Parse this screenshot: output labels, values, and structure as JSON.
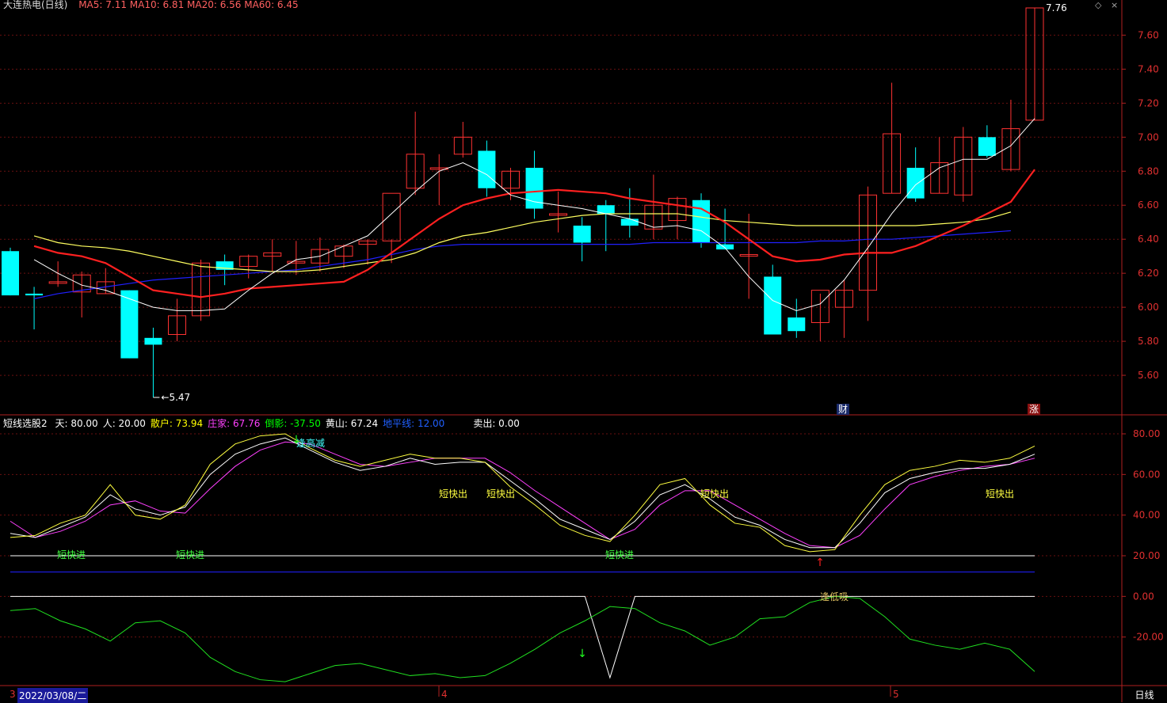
{
  "header": {
    "title_partial": "大连热电(日线)",
    "ma_partial": "MA5: 7.11  MA10: 6.81  MA20: 6.56  MA60: 6.45"
  },
  "top_controls": {
    "up": "◇",
    "close": "×"
  },
  "price_axis": {
    "ticks": [
      "7.60",
      "7.40",
      "7.20",
      "7.00",
      "6.80",
      "6.60",
      "6.40",
      "6.20",
      "6.00",
      "5.80",
      "5.60"
    ]
  },
  "price_labels": {
    "high": "7.76",
    "low": "5.47"
  },
  "badges": {
    "cai": "财",
    "zhang": "涨"
  },
  "indicator": {
    "name": "短线选股2",
    "params": [
      {
        "label": "天: 80.00",
        "color": "#ffffff"
      },
      {
        "label": "人: 20.00",
        "color": "#ffffff"
      },
      {
        "label": "散户: 73.94",
        "color": "#ffff00"
      },
      {
        "label": "庄家: 67.76",
        "color": "#ff40ff"
      },
      {
        "label": "倒影: -37.50",
        "color": "#00ff00"
      },
      {
        "label": "黄山: 67.24",
        "color": "#ffffff"
      },
      {
        "label": "地平线: 12.00",
        "color": "#2060ff"
      },
      {
        "label": "卖出: 0.00",
        "color": "#ffffff"
      }
    ],
    "axis_ticks": [
      "80.00",
      "60.00",
      "40.00",
      "20.00",
      "0.00",
      "-20.00"
    ],
    "signals": {
      "kuaijin": "短快进",
      "kuaichu": "短快出",
      "fenggaojian": "逢高减",
      "fengdixi": "逢低吸"
    }
  },
  "bottom": {
    "date": "2022/03/08/二",
    "month4": "4",
    "month5": "5",
    "period": "日线",
    "left_tick": "3"
  },
  "colors": {
    "up": "#ff3232",
    "down": "#00ffff",
    "ma5": "#ffffff",
    "ma10": "#ff2020",
    "ma20": "#ffff60",
    "ma60": "#2020ff"
  },
  "chart_data": {
    "type": "candlestick",
    "candles": [
      {
        "o": 6.33,
        "h": 6.35,
        "l": 6.07,
        "c": 6.07
      },
      {
        "o": 6.08,
        "h": 6.12,
        "l": 5.87,
        "c": 6.07
      },
      {
        "o": 6.15,
        "h": 6.27,
        "l": 6.12,
        "c": 6.15
      },
      {
        "o": 6.09,
        "h": 6.21,
        "l": 5.94,
        "c": 6.19
      },
      {
        "o": 6.08,
        "h": 6.23,
        "l": 6.08,
        "c": 6.15
      },
      {
        "o": 6.1,
        "h": 6.1,
        "l": 5.7,
        "c": 5.7
      },
      {
        "o": 5.82,
        "h": 5.88,
        "l": 5.47,
        "c": 5.78
      },
      {
        "o": 5.84,
        "h": 6.05,
        "l": 5.8,
        "c": 5.95
      },
      {
        "o": 5.95,
        "h": 6.28,
        "l": 5.92,
        "c": 6.26
      },
      {
        "o": 6.27,
        "h": 6.31,
        "l": 6.13,
        "c": 6.22
      },
      {
        "o": 6.24,
        "h": 6.31,
        "l": 6.17,
        "c": 6.3
      },
      {
        "o": 6.3,
        "h": 6.4,
        "l": 6.21,
        "c": 6.32
      },
      {
        "o": 6.26,
        "h": 6.39,
        "l": 6.19,
        "c": 6.27
      },
      {
        "o": 6.26,
        "h": 6.41,
        "l": 6.21,
        "c": 6.34
      },
      {
        "o": 6.3,
        "h": 6.37,
        "l": 6.23,
        "c": 6.36
      },
      {
        "o": 6.37,
        "h": 6.4,
        "l": 6.25,
        "c": 6.39
      },
      {
        "o": 6.39,
        "h": 6.4,
        "l": 6.26,
        "c": 6.67
      },
      {
        "o": 6.7,
        "h": 7.15,
        "l": 6.66,
        "c": 6.9
      },
      {
        "o": 6.82,
        "h": 6.9,
        "l": 6.6,
        "c": 6.82
      },
      {
        "o": 6.9,
        "h": 7.09,
        "l": 6.88,
        "c": 7.0
      },
      {
        "o": 6.92,
        "h": 6.98,
        "l": 6.65,
        "c": 6.7
      },
      {
        "o": 6.7,
        "h": 6.82,
        "l": 6.63,
        "c": 6.8
      },
      {
        "o": 6.82,
        "h": 6.92,
        "l": 6.52,
        "c": 6.58
      },
      {
        "o": 6.55,
        "h": 6.68,
        "l": 6.44,
        "c": 6.55
      },
      {
        "o": 6.48,
        "h": 6.53,
        "l": 6.27,
        "c": 6.38
      },
      {
        "o": 6.6,
        "h": 6.63,
        "l": 6.33,
        "c": 6.55
      },
      {
        "o": 6.52,
        "h": 6.7,
        "l": 6.41,
        "c": 6.48
      },
      {
        "o": 6.46,
        "h": 6.78,
        "l": 6.4,
        "c": 6.6
      },
      {
        "o": 6.51,
        "h": 6.65,
        "l": 6.4,
        "c": 6.64
      },
      {
        "o": 6.63,
        "h": 6.67,
        "l": 6.35,
        "c": 6.38
      },
      {
        "o": 6.37,
        "h": 6.58,
        "l": 6.34,
        "c": 6.34
      },
      {
        "o": 6.31,
        "h": 6.55,
        "l": 6.05,
        "c": 6.31
      },
      {
        "o": 6.18,
        "h": 6.25,
        "l": 5.84,
        "c": 5.84
      },
      {
        "o": 5.94,
        "h": 6.05,
        "l": 5.82,
        "c": 5.86
      },
      {
        "o": 5.91,
        "h": 6.08,
        "l": 5.8,
        "c": 6.1
      },
      {
        "o": 6.0,
        "h": 6.16,
        "l": 5.82,
        "c": 6.1
      },
      {
        "o": 6.1,
        "h": 6.71,
        "l": 5.92,
        "c": 6.66
      },
      {
        "o": 6.67,
        "h": 7.32,
        "l": 6.67,
        "c": 7.02
      },
      {
        "o": 6.82,
        "h": 6.94,
        "l": 6.62,
        "c": 6.64
      },
      {
        "o": 6.67,
        "h": 7.0,
        "l": 6.67,
        "c": 6.85
      },
      {
        "o": 6.66,
        "h": 7.06,
        "l": 6.62,
        "c": 7.0
      },
      {
        "o": 7.0,
        "h": 7.07,
        "l": 6.88,
        "c": 6.89
      },
      {
        "o": 6.81,
        "h": 7.22,
        "l": 6.8,
        "c": 7.05
      },
      {
        "o": 7.1,
        "h": 7.76,
        "l": 7.1,
        "c": 7.76
      }
    ],
    "ma5": [
      6.28,
      6.2,
      6.13,
      6.1,
      6.05,
      6.0,
      5.98,
      5.98,
      5.99,
      6.1,
      6.2,
      6.28,
      6.3,
      6.36,
      6.42,
      6.55,
      6.68,
      6.8,
      6.85,
      6.78,
      6.66,
      6.62,
      6.6,
      6.58,
      6.55,
      6.52,
      6.47,
      6.48,
      6.45,
      6.35,
      6.18,
      6.04,
      5.98,
      6.02,
      6.16,
      6.35,
      6.55,
      6.72,
      6.82,
      6.87,
      6.87,
      6.95,
      7.11
    ],
    "ma10": [
      6.36,
      6.32,
      6.3,
      6.26,
      6.18,
      6.1,
      6.08,
      6.06,
      6.08,
      6.11,
      6.12,
      6.13,
      6.14,
      6.15,
      6.22,
      6.32,
      6.42,
      6.52,
      6.6,
      6.64,
      6.67,
      6.68,
      6.69,
      6.68,
      6.67,
      6.64,
      6.62,
      6.6,
      6.58,
      6.5,
      6.4,
      6.3,
      6.27,
      6.28,
      6.31,
      6.32,
      6.32,
      6.36,
      6.42,
      6.48,
      6.55,
      6.62,
      6.81
    ],
    "ma20": [
      6.42,
      6.38,
      6.36,
      6.35,
      6.33,
      6.3,
      6.27,
      6.24,
      6.23,
      6.22,
      6.21,
      6.21,
      6.22,
      6.24,
      6.26,
      6.28,
      6.32,
      6.38,
      6.42,
      6.44,
      6.47,
      6.5,
      6.52,
      6.54,
      6.55,
      6.55,
      6.55,
      6.55,
      6.53,
      6.51,
      6.5,
      6.49,
      6.48,
      6.48,
      6.48,
      6.48,
      6.48,
      6.48,
      6.49,
      6.5,
      6.52,
      6.56
    ],
    "ma60": [
      6.05,
      6.08,
      6.1,
      6.12,
      6.14,
      6.16,
      6.17,
      6.18,
      6.19,
      6.2,
      6.21,
      6.22,
      6.24,
      6.26,
      6.28,
      6.31,
      6.34,
      6.36,
      6.37,
      6.37,
      6.37,
      6.37,
      6.37,
      6.37,
      6.37,
      6.37,
      6.38,
      6.38,
      6.38,
      6.38,
      6.38,
      6.38,
      6.38,
      6.39,
      6.39,
      6.4,
      6.4,
      6.41,
      6.42,
      6.43,
      6.44,
      6.45
    ],
    "ind_yellow": [
      29,
      30,
      36,
      40,
      55,
      40,
      38,
      45,
      65,
      75,
      79,
      80,
      73,
      67,
      64,
      67,
      70,
      68,
      68,
      66,
      54,
      45,
      35,
      30,
      27,
      40,
      55,
      58,
      45,
      36,
      34,
      25,
      22,
      23,
      40,
      55,
      62,
      64,
      67,
      66,
      68,
      74
    ],
    "ind_white": [
      31,
      29,
      34,
      39,
      50,
      43,
      40,
      44,
      60,
      70,
      75,
      78,
      72,
      66,
      62,
      64,
      68,
      65,
      66,
      66,
      57,
      48,
      38,
      33,
      28,
      37,
      50,
      55,
      48,
      39,
      35,
      28,
      24,
      24,
      36,
      51,
      58,
      61,
      63,
      63,
      65,
      70
    ],
    "ind_magenta": [
      37,
      29,
      32,
      37,
      45,
      47,
      42,
      41,
      53,
      64,
      72,
      76,
      75,
      70,
      65,
      64,
      66,
      68,
      68,
      68,
      61,
      52,
      44,
      36,
      28,
      33,
      45,
      52,
      52,
      45,
      38,
      31,
      25,
      24,
      30,
      43,
      55,
      59,
      62,
      64,
      65,
      68
    ],
    "ind_green": [
      -7,
      -6,
      -12,
      -16,
      -22,
      -13,
      -12,
      -18,
      -30,
      -37,
      -41,
      -42,
      -38,
      -34,
      -33,
      -36,
      -39,
      -38,
      -40,
      -39,
      -33,
      -26,
      -18,
      -12,
      -5,
      -6,
      -13,
      -17,
      -24,
      -20,
      -11,
      -10,
      -3,
      0,
      -1,
      -10,
      -21,
      -24,
      -26,
      -23,
      -26,
      -37
    ],
    "ind_white2": [
      0,
      0,
      0,
      0,
      0,
      0,
      0,
      0,
      0,
      0,
      0,
      0,
      0,
      0,
      0,
      0,
      0,
      0,
      0,
      0,
      0,
      0,
      0,
      0,
      -40,
      0,
      0,
      0,
      0,
      0,
      0,
      0,
      0,
      0,
      0,
      0,
      0,
      0,
      0,
      0,
      0,
      0
    ],
    "hlines": [
      20,
      12,
      0
    ]
  }
}
